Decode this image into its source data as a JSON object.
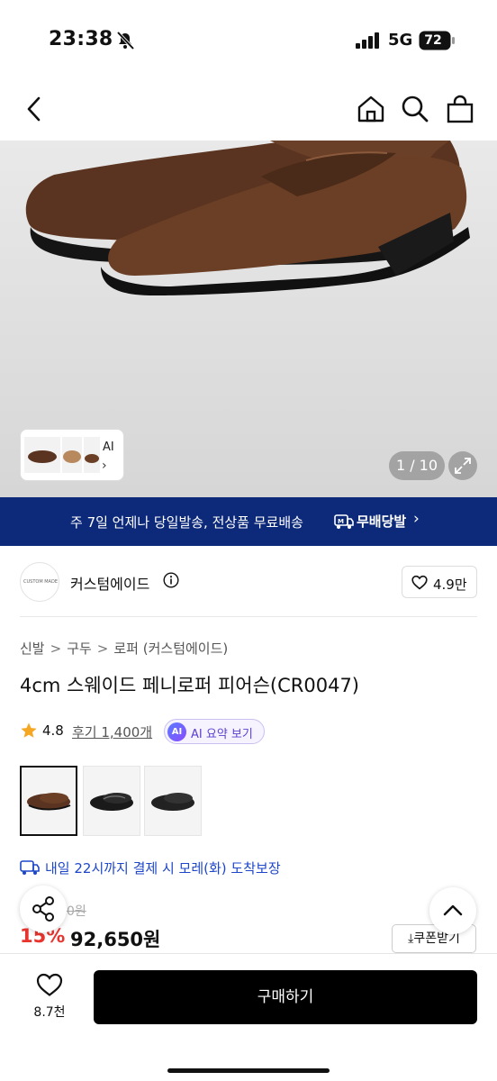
{
  "status_bar": {
    "time": "23:38",
    "network": "5G",
    "battery": "72"
  },
  "nav": {
    "back_icon": "chevron-left-icon",
    "home_icon": "home-icon",
    "search_icon": "search-icon",
    "cart_icon": "shopping-bag-icon"
  },
  "gallery": {
    "thumb_label": "AI",
    "counter": "1 / 10"
  },
  "promo": {
    "text": "주 7일 언제나 당일발송, 전상품 무료배송",
    "badge": "무배당발",
    "background": "#0d2a7a"
  },
  "brand": {
    "name": "커스텀에이드",
    "logo_text": "CUSTOM MADE",
    "likes": "4.9만"
  },
  "breadcrumb": [
    "신발",
    "구두",
    "로퍼 (커스텀에이드)"
  ],
  "product": {
    "title": "4cm 스웨이드 페니로퍼 피어슨(CR0047)",
    "rating": "4.8",
    "reviews": "후기 1,400개",
    "ai_summary": "AI 요약 보기",
    "ai_badge": "AI"
  },
  "colors": [
    "brown suede",
    "black leather",
    "black suede"
  ],
  "delivery": {
    "text": "내일 22시까지 결제 시 모레(화) 도착보장"
  },
  "price": {
    "original": "0원",
    "discount": "15%",
    "sale": "92,650원",
    "coupon": "쿠폰받기"
  },
  "bottom": {
    "wish_count": "8.7천",
    "buy_label": "구매하기"
  },
  "accent": {
    "sale_red": "#e8332e",
    "link_blue": "#1d46c8",
    "ai_purple": "#5b3fd0"
  }
}
